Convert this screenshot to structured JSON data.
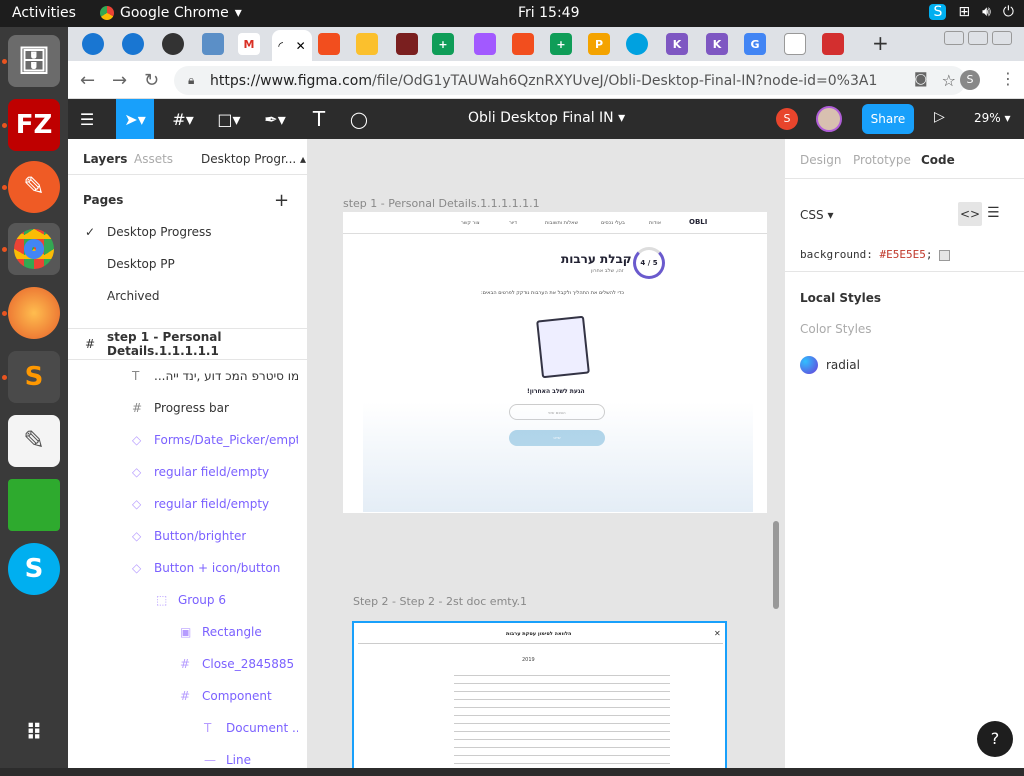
{
  "system": {
    "activities": "Activities",
    "app_name": "Google Chrome",
    "clock": "Fri 15:49"
  },
  "browser": {
    "url_host": "https://www.figma.com",
    "url_path": "/file/OdG1yTAUWah6QznRXYUveJ/Obli-Desktop-Final-IN?node-id=0%3A1",
    "profile": "S"
  },
  "figma": {
    "file_title": "Obli Desktop Final IN",
    "share_label": "Share",
    "zoom": "29%",
    "avatar": "S",
    "left_tabs": {
      "layers": "Layers",
      "assets": "Assets",
      "page_menu": "Desktop Progr..."
    },
    "pages_header": "Pages",
    "pages": [
      "Desktop Progress",
      "Desktop PP",
      "Archived"
    ],
    "frame_layer": "step 1 - Personal Details.1.1.1.1.1",
    "layers": [
      {
        "name": "...קתמו סיטרפ המכ דוע ,ינד ייה",
        "icon": "T",
        "indent": 0,
        "purple": false
      },
      {
        "name": "Progress bar",
        "icon": "#",
        "indent": 0,
        "purple": false
      },
      {
        "name": "Forms/Date_Picker/empty",
        "icon": "◇",
        "indent": 0,
        "purple": true
      },
      {
        "name": "regular field/empty",
        "icon": "◇",
        "indent": 0,
        "purple": true
      },
      {
        "name": "regular field/empty",
        "icon": "◇",
        "indent": 0,
        "purple": true
      },
      {
        "name": "Button/brighter",
        "icon": "◇",
        "indent": 0,
        "purple": true
      },
      {
        "name": "Button + icon/button",
        "icon": "◇",
        "indent": 0,
        "purple": true
      },
      {
        "name": "Group 6",
        "icon": "⬚",
        "indent": 1,
        "purple": true
      },
      {
        "name": "Rectangle",
        "icon": "▣",
        "indent": 2,
        "purple": true
      },
      {
        "name": "Close_2845885",
        "icon": "#",
        "indent": 2,
        "purple": true
      },
      {
        "name": "Component",
        "icon": "#",
        "indent": 2,
        "purple": true
      },
      {
        "name": "Document ...",
        "icon": "T",
        "indent": 3,
        "purple": true
      },
      {
        "name": "Line",
        "icon": "—",
        "indent": 3,
        "purple": true
      }
    ],
    "right_tabs": {
      "design": "Design",
      "prototype": "Prototype",
      "code": "Code"
    },
    "code_lang": "CSS",
    "css_prop": "background:",
    "css_value": "#E5E5E5",
    "local_styles": "Local Styles",
    "color_styles": "Color Styles",
    "style_name": "radial",
    "help": "?"
  },
  "canvas": {
    "frame1_label": "step 1 - Personal Details.1.1.1.1.1.1",
    "frame2_label": "Step 2 - Step 2 - 2st doc emty.1",
    "f1": {
      "nav": [
        "צור קשר",
        "דיור",
        "שאלות ותשובות",
        "בעלי נכסים",
        "אודות"
      ],
      "logo": "OBLI",
      "heading": "קבלת ערבות",
      "sub": "זהו, שלב אחרון",
      "progress": "4 / 5",
      "desc": "כדי להשלים את התהליך ולקבל את הערבות נודקק לפרטים הבאים:",
      "step_title": "הגעת לשלב האחרון!",
      "field": "הסכם שווי",
      "button": "שייט"
    },
    "f2": {
      "title": "הלוואה לסימון עסקת ערבות",
      "close": "✕",
      "year": "2019"
    }
  }
}
